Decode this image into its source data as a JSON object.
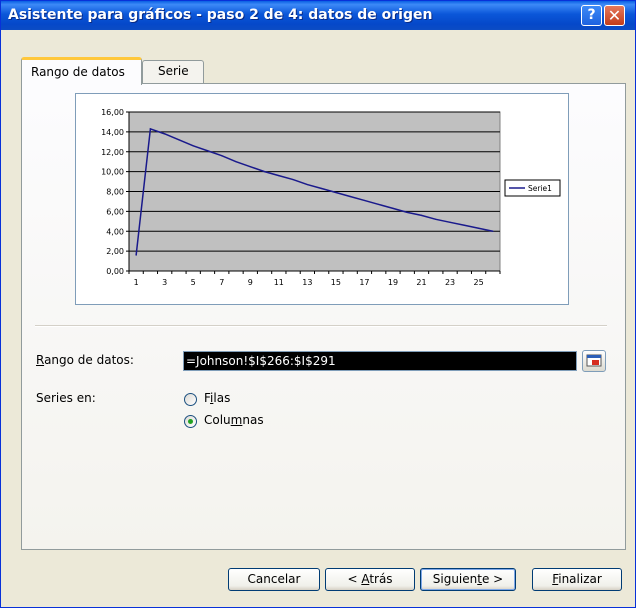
{
  "window": {
    "title": "Asistente para gráficos - paso 2 de 4: datos de origen",
    "help_label": "?",
    "close_label": "✕"
  },
  "tabs": [
    {
      "label": "Rango de datos"
    },
    {
      "label": "Serie"
    }
  ],
  "form": {
    "range_label": "Rango de datos:",
    "range_value": "=Johnson!$I$266:$I$291",
    "series_in_label": "Series en:",
    "options": [
      {
        "label": "Filas",
        "checked": false
      },
      {
        "label": "Columnas",
        "checked": true
      }
    ]
  },
  "buttons": {
    "cancel": "Cancelar",
    "back": "< Atrás",
    "next": "Siguiente >",
    "finish": "Finalizar"
  },
  "chart_data": {
    "type": "line",
    "categories": [
      1,
      2,
      3,
      4,
      5,
      6,
      7,
      8,
      9,
      10,
      11,
      12,
      13,
      14,
      15,
      16,
      17,
      18,
      19,
      20,
      21,
      22,
      23,
      24,
      25,
      26
    ],
    "x_tick_labels": [
      "1",
      "3",
      "5",
      "7",
      "9",
      "11",
      "13",
      "15",
      "17",
      "19",
      "21",
      "23",
      "25"
    ],
    "y_tick_labels": [
      "0,00",
      "2,00",
      "4,00",
      "6,00",
      "8,00",
      "10,00",
      "12,00",
      "14,00",
      "16,00"
    ],
    "ylim": [
      0,
      16
    ],
    "grid": true,
    "legend": "right",
    "series": [
      {
        "name": "Serie1",
        "values": [
          1.6,
          14.3,
          13.8,
          13.2,
          12.6,
          12.1,
          11.6,
          11.0,
          10.5,
          10.0,
          9.6,
          9.2,
          8.7,
          8.3,
          7.9,
          7.5,
          7.1,
          6.7,
          6.3,
          5.9,
          5.6,
          5.2,
          4.9,
          4.6,
          4.3,
          4.0
        ]
      }
    ]
  }
}
